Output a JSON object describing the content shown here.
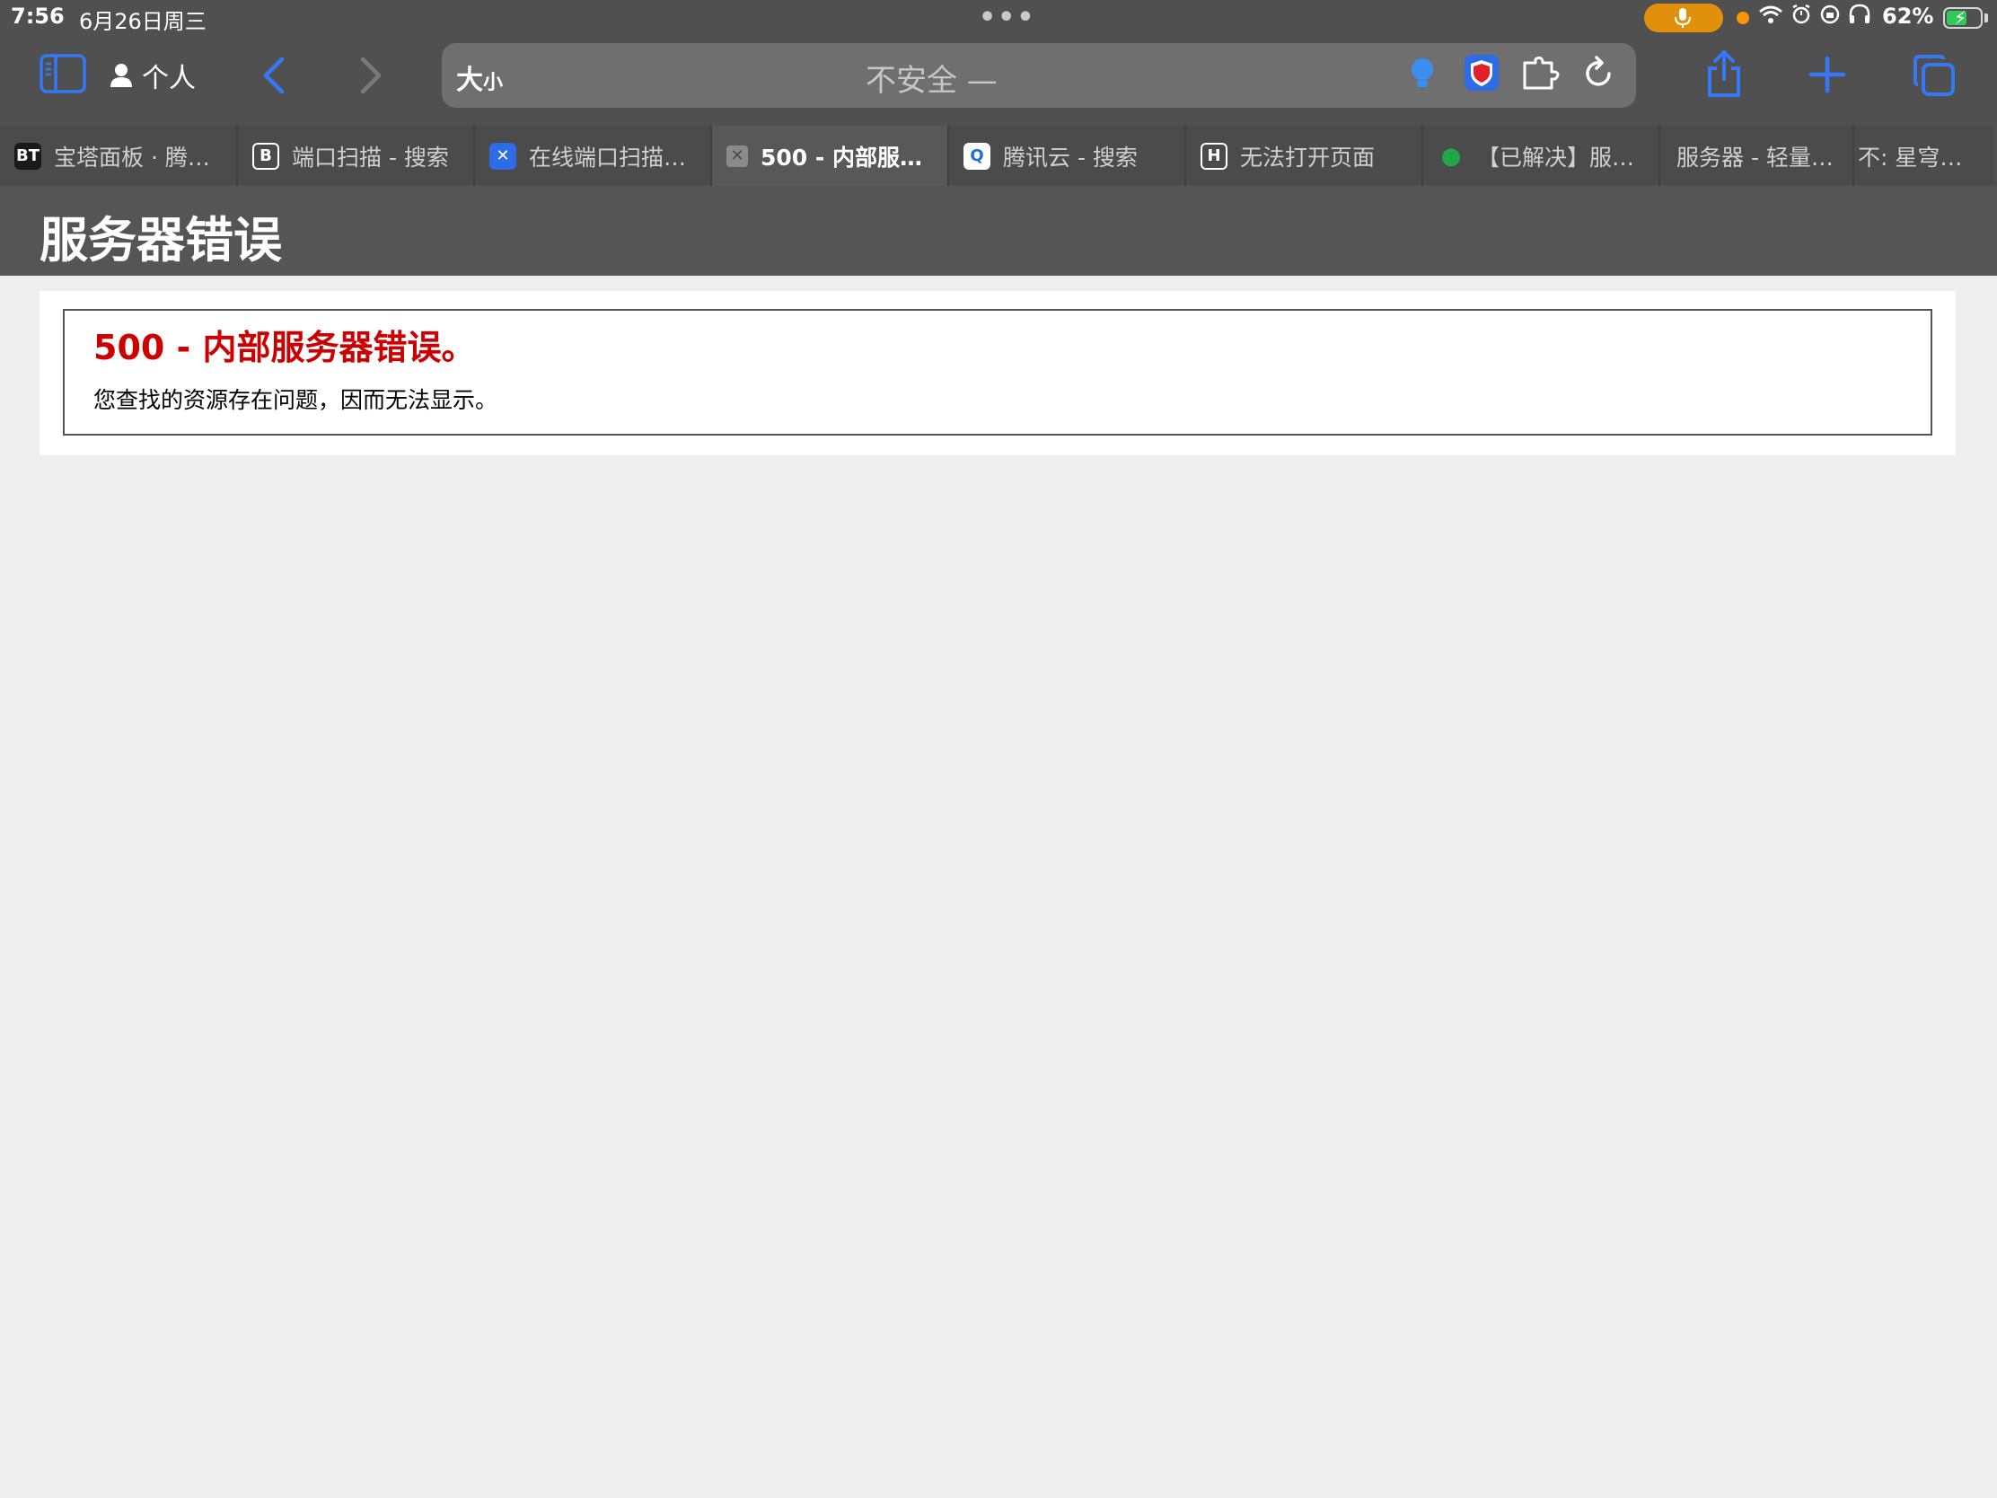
{
  "status_bar": {
    "time": "7:56",
    "date": "6月26日周三",
    "battery_percent": "62%",
    "battery_level": 0.62,
    "mic_pill_color": "#e0900a"
  },
  "toolbar": {
    "profile_label": "个人",
    "address": {
      "text_size_label": "大",
      "text_size_small": "小",
      "text": "不安全 —"
    }
  },
  "tabs": [
    {
      "favicon": "BT",
      "label": "宝塔面板 · 腾…",
      "favicon_bg": "#1a1a1a",
      "favicon_color": "#ffffff"
    },
    {
      "favicon": "B",
      "label": "端口扫描 - 搜索",
      "favicon_bg": "#ffffff",
      "favicon_color": "#1a1a1a"
    },
    {
      "favicon": "✕",
      "label": "在线端口扫描…",
      "favicon_bg": "#2e6be6",
      "favicon_color": "#ffffff"
    },
    {
      "favicon": "✕",
      "label": "500 - 内部服…",
      "favicon_bg": "#8a8a8a",
      "favicon_color": "#ffffff",
      "active": true
    },
    {
      "favicon": "Q",
      "label": "腾讯云 - 搜索",
      "favicon_bg": "#ffffff",
      "favicon_color": "#1a6fd8"
    },
    {
      "favicon": "H",
      "label": "无法打开页面",
      "favicon_bg": "#ffffff",
      "favicon_color": "#1a1a1a"
    },
    {
      "favicon": "●",
      "label": "【已解决】服…",
      "favicon_bg": "#4b4b4b",
      "favicon_color": "#1fa84a"
    },
    {
      "favicon": "",
      "label": "服务器 - 轻量…",
      "favicon_bg": "#4b4b4b",
      "favicon_color": "#2e6be6"
    },
    {
      "favicon": "",
      "label": "不: 星穹…",
      "favicon_bg": "#4b4b4b",
      "favicon_color": "#4b4b4b"
    }
  ],
  "page": {
    "header_title": "服务器错误",
    "error_title": "500 - 内部服务器错误。",
    "error_description": "您查找的资源存在问题，因而无法显示。"
  },
  "colors": {
    "accent_blue": "#3478f6",
    "error_red": "#cc0000"
  }
}
